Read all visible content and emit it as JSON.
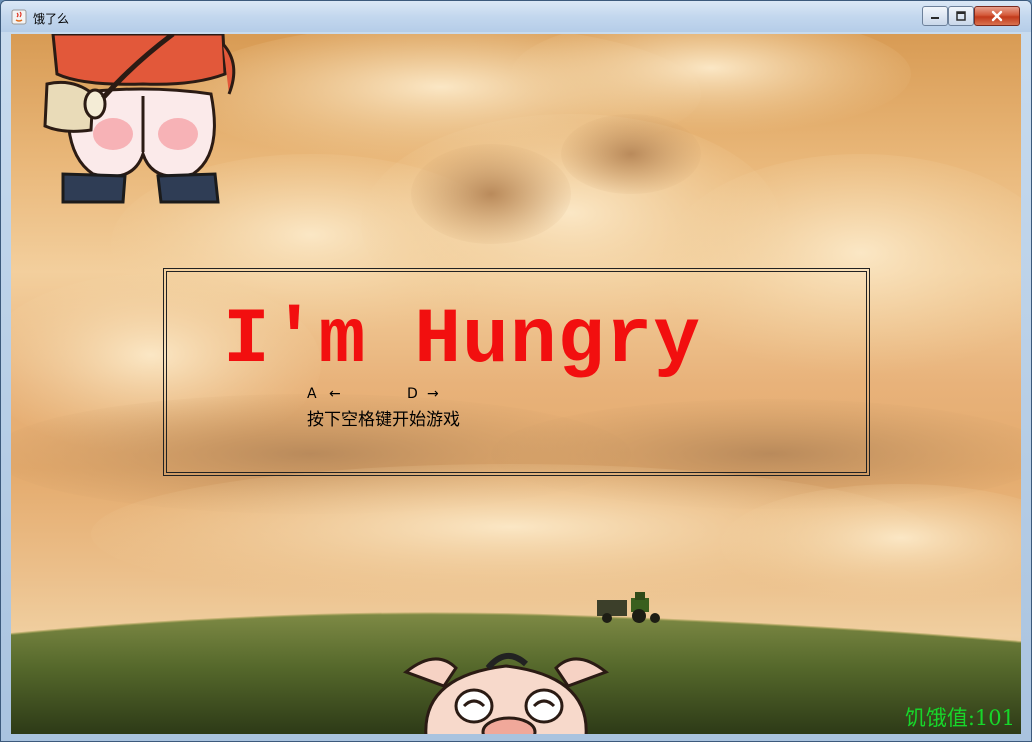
{
  "window": {
    "title": "饿了么",
    "controls": {
      "minimize": "minimize-icon",
      "maximize": "maximize-icon",
      "close": "close-icon"
    }
  },
  "game": {
    "title": "I'm Hungry",
    "key_left": "A",
    "key_left_arrow": "←",
    "key_right": "D",
    "key_right_arrow": "→",
    "start_hint": "按下空格键开始游戏",
    "hunger_label": "饥饿值:",
    "hunger_value": "101"
  },
  "sprites": [
    "butt-character",
    "pig-character",
    "tractor"
  ],
  "colors": {
    "title_red": "#f20f0f",
    "hunger_green": "#17d62a"
  }
}
